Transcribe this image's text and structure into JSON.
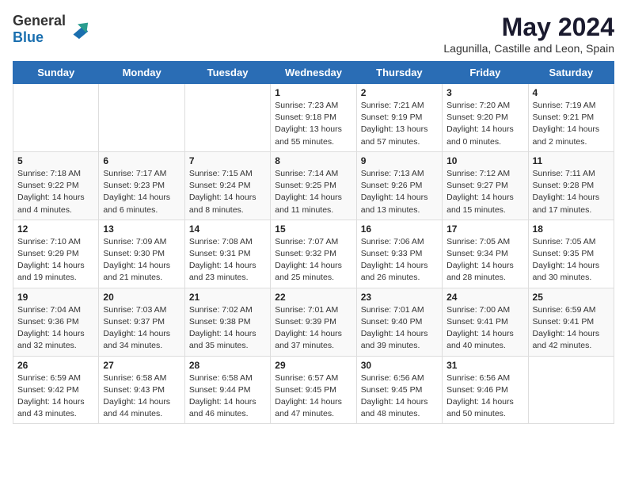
{
  "header": {
    "logo_general": "General",
    "logo_blue": "Blue",
    "month": "May 2024",
    "location": "Lagunilla, Castille and Leon, Spain"
  },
  "days_of_week": [
    "Sunday",
    "Monday",
    "Tuesday",
    "Wednesday",
    "Thursday",
    "Friday",
    "Saturday"
  ],
  "weeks": [
    [
      {
        "day": "",
        "info": ""
      },
      {
        "day": "",
        "info": ""
      },
      {
        "day": "",
        "info": ""
      },
      {
        "day": "1",
        "info": "Sunrise: 7:23 AM\nSunset: 9:18 PM\nDaylight: 13 hours and 55 minutes."
      },
      {
        "day": "2",
        "info": "Sunrise: 7:21 AM\nSunset: 9:19 PM\nDaylight: 13 hours and 57 minutes."
      },
      {
        "day": "3",
        "info": "Sunrise: 7:20 AM\nSunset: 9:20 PM\nDaylight: 14 hours and 0 minutes."
      },
      {
        "day": "4",
        "info": "Sunrise: 7:19 AM\nSunset: 9:21 PM\nDaylight: 14 hours and 2 minutes."
      }
    ],
    [
      {
        "day": "5",
        "info": "Sunrise: 7:18 AM\nSunset: 9:22 PM\nDaylight: 14 hours and 4 minutes."
      },
      {
        "day": "6",
        "info": "Sunrise: 7:17 AM\nSunset: 9:23 PM\nDaylight: 14 hours and 6 minutes."
      },
      {
        "day": "7",
        "info": "Sunrise: 7:15 AM\nSunset: 9:24 PM\nDaylight: 14 hours and 8 minutes."
      },
      {
        "day": "8",
        "info": "Sunrise: 7:14 AM\nSunset: 9:25 PM\nDaylight: 14 hours and 11 minutes."
      },
      {
        "day": "9",
        "info": "Sunrise: 7:13 AM\nSunset: 9:26 PM\nDaylight: 14 hours and 13 minutes."
      },
      {
        "day": "10",
        "info": "Sunrise: 7:12 AM\nSunset: 9:27 PM\nDaylight: 14 hours and 15 minutes."
      },
      {
        "day": "11",
        "info": "Sunrise: 7:11 AM\nSunset: 9:28 PM\nDaylight: 14 hours and 17 minutes."
      }
    ],
    [
      {
        "day": "12",
        "info": "Sunrise: 7:10 AM\nSunset: 9:29 PM\nDaylight: 14 hours and 19 minutes."
      },
      {
        "day": "13",
        "info": "Sunrise: 7:09 AM\nSunset: 9:30 PM\nDaylight: 14 hours and 21 minutes."
      },
      {
        "day": "14",
        "info": "Sunrise: 7:08 AM\nSunset: 9:31 PM\nDaylight: 14 hours and 23 minutes."
      },
      {
        "day": "15",
        "info": "Sunrise: 7:07 AM\nSunset: 9:32 PM\nDaylight: 14 hours and 25 minutes."
      },
      {
        "day": "16",
        "info": "Sunrise: 7:06 AM\nSunset: 9:33 PM\nDaylight: 14 hours and 26 minutes."
      },
      {
        "day": "17",
        "info": "Sunrise: 7:05 AM\nSunset: 9:34 PM\nDaylight: 14 hours and 28 minutes."
      },
      {
        "day": "18",
        "info": "Sunrise: 7:05 AM\nSunset: 9:35 PM\nDaylight: 14 hours and 30 minutes."
      }
    ],
    [
      {
        "day": "19",
        "info": "Sunrise: 7:04 AM\nSunset: 9:36 PM\nDaylight: 14 hours and 32 minutes."
      },
      {
        "day": "20",
        "info": "Sunrise: 7:03 AM\nSunset: 9:37 PM\nDaylight: 14 hours and 34 minutes."
      },
      {
        "day": "21",
        "info": "Sunrise: 7:02 AM\nSunset: 9:38 PM\nDaylight: 14 hours and 35 minutes."
      },
      {
        "day": "22",
        "info": "Sunrise: 7:01 AM\nSunset: 9:39 PM\nDaylight: 14 hours and 37 minutes."
      },
      {
        "day": "23",
        "info": "Sunrise: 7:01 AM\nSunset: 9:40 PM\nDaylight: 14 hours and 39 minutes."
      },
      {
        "day": "24",
        "info": "Sunrise: 7:00 AM\nSunset: 9:41 PM\nDaylight: 14 hours and 40 minutes."
      },
      {
        "day": "25",
        "info": "Sunrise: 6:59 AM\nSunset: 9:41 PM\nDaylight: 14 hours and 42 minutes."
      }
    ],
    [
      {
        "day": "26",
        "info": "Sunrise: 6:59 AM\nSunset: 9:42 PM\nDaylight: 14 hours and 43 minutes."
      },
      {
        "day": "27",
        "info": "Sunrise: 6:58 AM\nSunset: 9:43 PM\nDaylight: 14 hours and 44 minutes."
      },
      {
        "day": "28",
        "info": "Sunrise: 6:58 AM\nSunset: 9:44 PM\nDaylight: 14 hours and 46 minutes."
      },
      {
        "day": "29",
        "info": "Sunrise: 6:57 AM\nSunset: 9:45 PM\nDaylight: 14 hours and 47 minutes."
      },
      {
        "day": "30",
        "info": "Sunrise: 6:56 AM\nSunset: 9:45 PM\nDaylight: 14 hours and 48 minutes."
      },
      {
        "day": "31",
        "info": "Sunrise: 6:56 AM\nSunset: 9:46 PM\nDaylight: 14 hours and 50 minutes."
      },
      {
        "day": "",
        "info": ""
      }
    ]
  ]
}
